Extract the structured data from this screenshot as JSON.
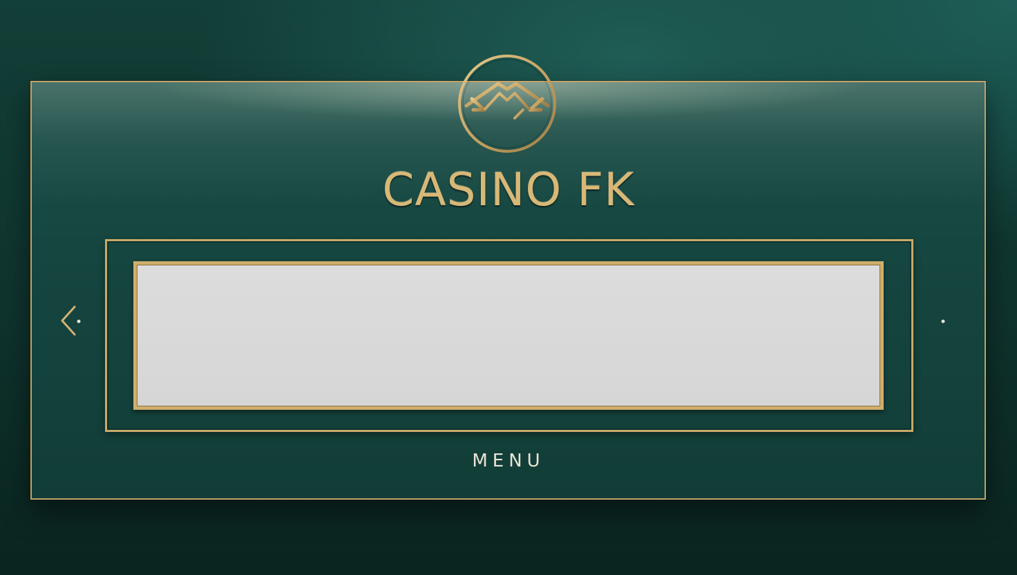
{
  "brand": {
    "title": "CASINO FK",
    "logo_icon": "diamond-emblem-icon"
  },
  "carousel": {
    "prev_icon": "chevron-left-icon",
    "next_icon": "dot-indicator-icon",
    "content_text": ""
  },
  "menu": {
    "label": "MENU"
  },
  "colors": {
    "background": "#134039",
    "gold": "#c9aa6a",
    "slot_fill": "#d8d8d8",
    "menu_text": "#e9e4d6"
  }
}
